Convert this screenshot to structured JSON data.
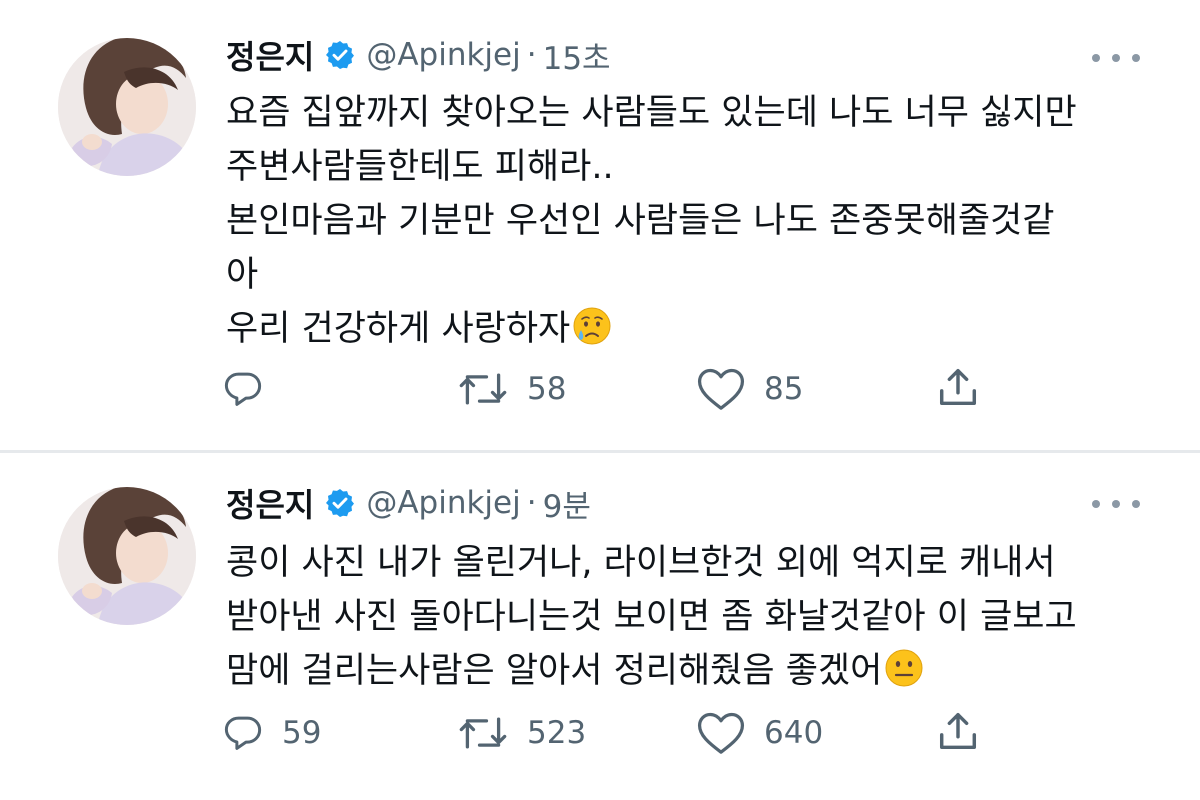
{
  "tweets": [
    {
      "author_name": "정은지",
      "handle": "@Apinkjej",
      "separator": "·",
      "timestamp": "15초",
      "text_lines": [
        "요즘 집앞까지 찾아오는 사람들도 있는데 나도 너무 싫지만",
        "주변사람들한테도 피해라..",
        "본인마음과 기분만 우선인 사람들은 나도 존중못해줄것같",
        "아",
        "우리 건강하게 사랑하자"
      ],
      "emoji": "crying-face",
      "replies": "",
      "retweets": "58",
      "likes": "85"
    },
    {
      "author_name": "정은지",
      "handle": "@Apinkjej",
      "separator": "·",
      "timestamp": "9분",
      "text_lines": [
        "콩이 사진 내가 올린거나, 라이브한것 외에 억지로 캐내서",
        "받아낸 사진 돌아다니는것 보이면 좀 화날것같아 이 글보고",
        "맘에 걸리는사람은 알아서 정리해줬음 좋겠어"
      ],
      "emoji": "neutral-face",
      "replies": "59",
      "retweets": "523",
      "likes": "640"
    }
  ],
  "icons": {
    "verified": "verified-badge-icon",
    "more": "more-icon",
    "reply": "reply-icon",
    "retweet": "retweet-icon",
    "like": "heart-icon",
    "share": "share-icon"
  },
  "colors": {
    "text": "#0f1419",
    "secondary": "#536471",
    "verified": "#1d9bf0",
    "divider": "#e6e9ec"
  }
}
